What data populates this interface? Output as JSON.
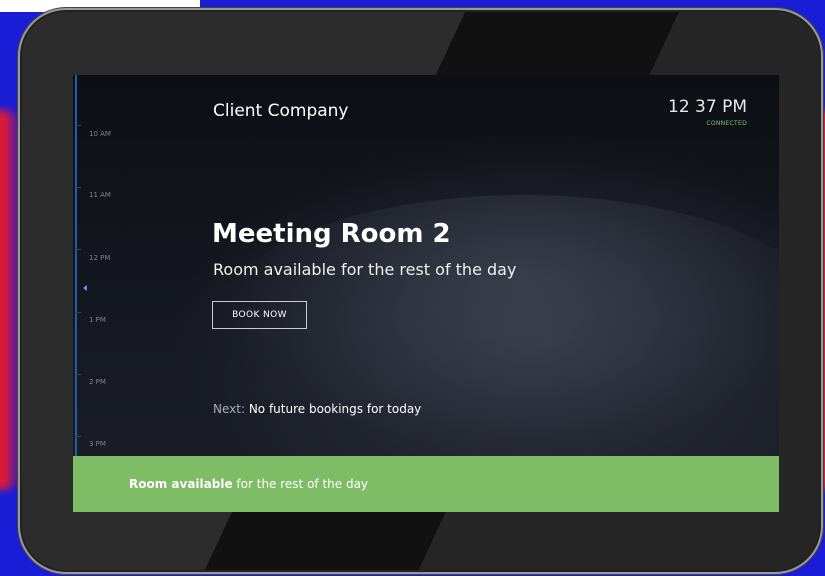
{
  "header": {
    "company": "Client Company",
    "time": "12 37 PM",
    "connection_status": "CONNECTED"
  },
  "timeline": {
    "labels": [
      "10 AM",
      "11 AM",
      "12 PM",
      "1 PM",
      "2 PM",
      "3 PM"
    ]
  },
  "room": {
    "name": "Meeting Room 2",
    "availability": "Room available for the rest of the day",
    "book_label": "BOOK NOW",
    "next_prefix": "Next:",
    "next_text": "No future bookings for today"
  },
  "footer": {
    "status_strong": "Room available",
    "status_rest": "for the rest of the day"
  },
  "colors": {
    "footer_green": "#7fbc66",
    "connected_green": "#7ec668",
    "timeline_blue": "#1f5ea8",
    "red_glow": "#ff1a1a",
    "backdrop_blue": "#1a1dd6"
  }
}
